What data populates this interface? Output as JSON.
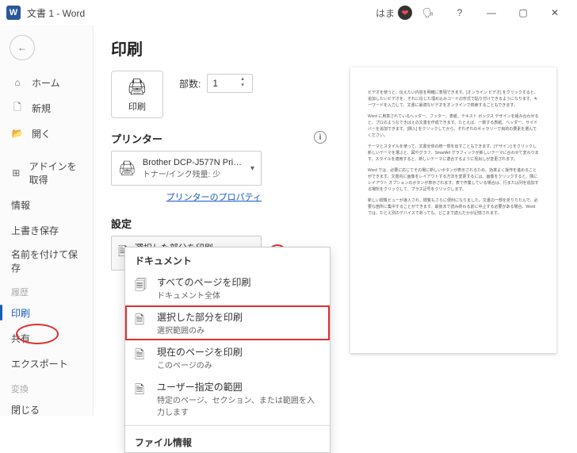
{
  "titlebar": {
    "app_icon_letter": "W",
    "doc_title": "文書 1 - Word",
    "user_name": "はま"
  },
  "sidebar": {
    "items": [
      {
        "icon": "⌂",
        "label": "ホーム"
      },
      {
        "icon": "🗋",
        "label": "新規"
      },
      {
        "icon": "📂",
        "label": "開く"
      }
    ],
    "addins": {
      "icon": "⊞",
      "label": "アドインを取得"
    },
    "items2": [
      {
        "label": "情報"
      },
      {
        "label": "上書き保存"
      },
      {
        "label": "名前を付けて保存"
      }
    ],
    "history_h": "履歴",
    "items3": [
      {
        "label": "印刷"
      },
      {
        "label": "共有"
      },
      {
        "label": "エクスポート"
      }
    ],
    "transform_h": "変換",
    "items4": [
      {
        "label": "閉じる"
      }
    ]
  },
  "content": {
    "title": "印刷",
    "print_btn": "印刷",
    "copies_label": "部数:",
    "copies_value": "1",
    "printer_h": "プリンター",
    "printer_name": "Brother DCP-J577N Pri…",
    "printer_status": "トナー/インク残量: 少",
    "printer_props": "プリンターのプロパティ",
    "settings_h": "設定",
    "settings_sel_t": "選択した部分を印刷",
    "settings_sel_s": "選択範囲のみ"
  },
  "dropdown": {
    "group": "ドキュメント",
    "opts": [
      {
        "t": "すべてのページを印刷",
        "s": "ドキュメント全体"
      },
      {
        "t": "選択した部分を印刷",
        "s": "選択範囲のみ"
      },
      {
        "t": "現在のページを印刷",
        "s": "このページのみ"
      },
      {
        "t": "ユーザー指定の範囲",
        "s": "特定のページ、セクション、または範囲を入力します"
      }
    ],
    "file_info": "ファイル情報"
  },
  "preview_paragraphs": [
    "ビデオを使うと、伝えたい内容を明確に表現できます。[オンライン ビデオ] をクリックすると、追加したいビデオを、それに応じた埋め込みコードの形式で貼り付けできるようになります。キーワードを入力して、文書に最適なビデオをオンラインで検索することもできます。",
    "Word に用意されているヘッダー、フッター、表紙、テキスト ボックス デザインを組み合わせると、プロのようなできばえの文書を作成できます。たとえば、一致する表紙、ヘッダー、サイドバーを追加できます。[挿入] をクリックしてから、それぞれのギャラリーで目的の要素を選んでください。",
    "テーマとスタイルを使って、文書全体の統一感を出すこともできます。[デザイン] をクリックし新しいテーマを選ぶと、図やグラフ、SmartArt グラフィックが新しいテーマに合わせて変わります。スタイルを適用すると、新しいテーマに適合するように見出しが変更されます。",
    "Word では、必要に応じてその場に新しいボタンが表示されるため、効率よく操作を進めることができます。文書内に画像をレイアウトする方法を変更するには、画像をクリックすると、隣にレイアウト オプションのボタンが表示されます。表で作業している場合は、行または列を追加する場所をクリックして、プラス記号をクリックします。",
    "新しい閲覧ビューが導入され、閲覧もさらに便利になりました。文書の一部を折りたたんで、必要な箇所に集中することができます。最後まで読み終わる前に中止する必要がある場合、Word では、たとえ別のデバイスであっても、どこまで読んだかが記憶されます。"
  ]
}
